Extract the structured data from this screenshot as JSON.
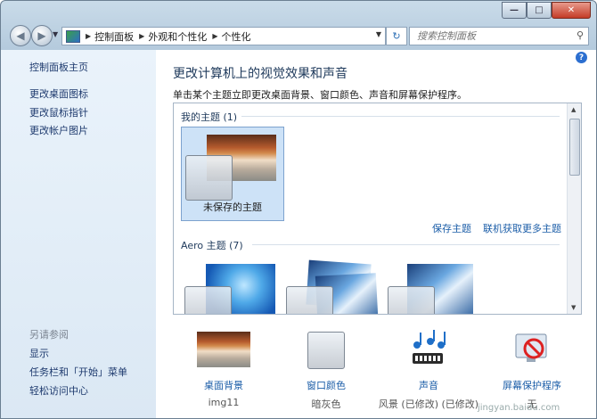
{
  "window": {
    "minimize": "—",
    "maximize": "□",
    "close": "✕"
  },
  "nav": {
    "back_icon": "back-arrow-icon",
    "forward_icon": "forward-arrow-icon",
    "breadcrumbs": [
      "控制面板",
      "外观和个性化",
      "个性化"
    ],
    "search_placeholder": "搜索控制面板"
  },
  "sidebar": {
    "links": [
      "控制面板主页",
      "更改桌面图标",
      "更改鼠标指针",
      "更改帐户图片"
    ],
    "see_also_title": "另请参阅",
    "see_also": [
      "显示",
      "任务栏和「开始」菜单",
      "轻松访问中心"
    ]
  },
  "main": {
    "heading": "更改计算机上的视觉效果和声音",
    "subheading": "单击某个主题立即更改桌面背景、窗口颜色、声音和屏幕保护程序。",
    "my_themes": "我的主题 (1)",
    "unsaved_theme": "未保存的主题",
    "save_theme": "保存主题",
    "get_more_themes": "联机获取更多主题",
    "aero_themes": "Aero 主题 (7)"
  },
  "bottom": [
    {
      "name": "桌面背景",
      "value": "img11"
    },
    {
      "name": "窗口颜色",
      "value": "暗灰色"
    },
    {
      "name": "声音",
      "value": "风景 (已修改) (已修改)"
    },
    {
      "name": "屏幕保护程序",
      "value": "无"
    }
  ],
  "watermark": "jingyan.baidu.com"
}
